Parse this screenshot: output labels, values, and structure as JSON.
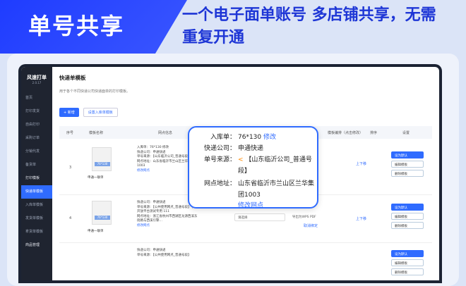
{
  "banner": {
    "tag": "单号共享",
    "headline": "一个电子面单账号 多店铺共享，无需重复开通"
  },
  "sidebar": {
    "logo": "风速打单",
    "ver": "2.0.17",
    "items": [
      "首页",
      "打印发货",
      "自由打印",
      "采购订单",
      "分销代发",
      "备货单",
      "打印模板",
      "快递单模板",
      "入库单模板",
      "发货单模板",
      "拿货单模板",
      "商品管理"
    ]
  },
  "page": {
    "title": "快递单模板",
    "desc": "用于各个不同快递公司快递面单的打印模板。",
    "add_btn": "+ 新增",
    "set_btn": "设置入库单模板"
  },
  "table": {
    "headers": [
      "序号",
      "模板名称",
      "网点信息",
      "模板编排（点击修改）",
      "排序",
      "设置"
    ]
  },
  "rows": [
    {
      "idx": "3",
      "badge": "76*130",
      "name": "申通一联单",
      "lines": [
        "入库单：76*130 修改",
        "快递公司：申通快递",
        "单号来源：【山东临沂公司_普通号段】",
        "网点地址：山东省临沂市兰山区兰华集团1003"
      ],
      "link": "修改网点",
      "sort": "上下移"
    },
    {
      "idx": "4",
      "badge": "76*130",
      "name": "申通一联单",
      "lines": [
        "快递公司：申通快递",
        "单号来源：【公共使用网点_普通号段】 抖店开放平台测试专用 111",
        "网点地址：浙江省杭州市西湖区龙源西溪东街路与西溪引擎…"
      ],
      "link": "修改网点",
      "select": "请选择",
      "export": "导出为WPS PDF",
      "cancel": "取消绑定",
      "sort": "上下移"
    },
    {
      "idx": "5",
      "badge": "",
      "name": "",
      "lines": [
        "快递公司：申通快递",
        "单号来源：【公共使用网点_普通号段】"
      ],
      "link": "",
      "sort": ""
    }
  ],
  "actions": [
    "设为默认",
    "编辑模板",
    "删除模板"
  ],
  "popup": {
    "k1": "入库单：",
    "v1": "76*130",
    "v1_link": "修改",
    "k2": "快递公司：",
    "v2": "申通快递",
    "k3": "单号来源：",
    "v3": "【山东临沂公司_普通号段】",
    "k4": "网点地址：",
    "v4": "山东省临沂市兰山区兰华集团1003",
    "link": "修改网点"
  }
}
